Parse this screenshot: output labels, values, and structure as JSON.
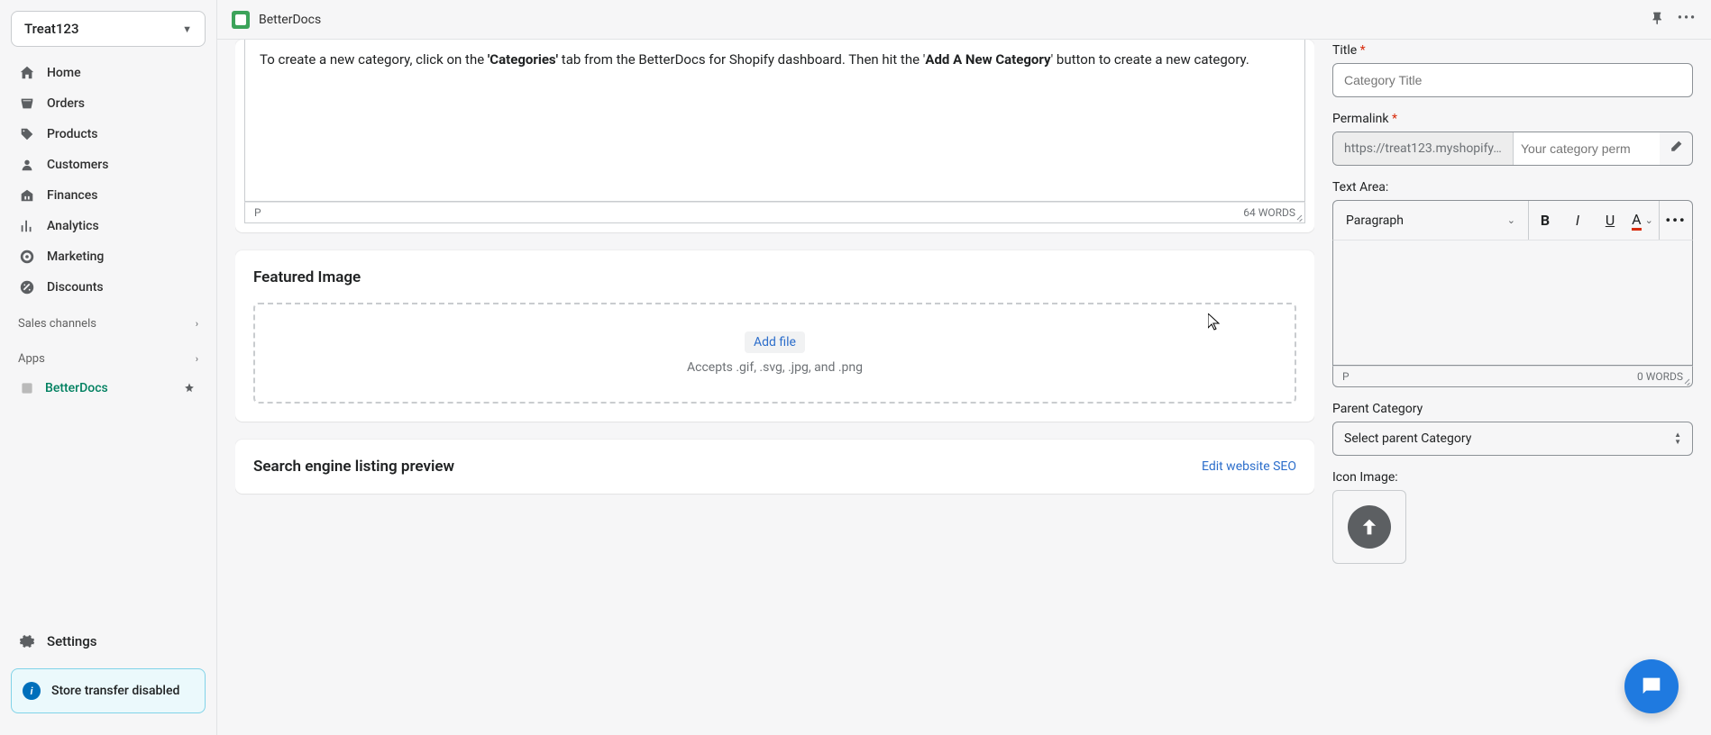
{
  "store": {
    "name": "Treat123"
  },
  "nav": {
    "home": "Home",
    "orders": "Orders",
    "products": "Products",
    "customers": "Customers",
    "finances": "Finances",
    "analytics": "Analytics",
    "marketing": "Marketing",
    "discounts": "Discounts",
    "salesChannels": "Sales channels",
    "apps": "Apps",
    "appItem": "BetterDocs",
    "settings": "Settings",
    "storeStatus": "Store transfer disabled"
  },
  "topbar": {
    "title": "BetterDocs"
  },
  "editor": {
    "body_pre": "To create a new category, click on the ",
    "body_bold1": "'Categories'",
    "body_mid": " tab from the BetterDocs for Shopify dashboard. Then hit the '",
    "body_bold2": "Add A New Category",
    "body_post": "' button to create a new category.",
    "pathLabel": "P",
    "wordCount": "64 WORDS"
  },
  "featured": {
    "title": "Featured Image",
    "addFile": "Add file",
    "accepts": "Accepts .gif, .svg, .jpg, and .png"
  },
  "seo": {
    "title": "Search engine listing preview",
    "editLink": "Edit website SEO"
  },
  "right": {
    "titleLabel": "Title",
    "titlePlaceholder": "Category Title",
    "permalinkLabel": "Permalink",
    "permalinkPrefix": "https://treat123.myshopify....",
    "permalinkPlaceholder": "Your category perm",
    "textAreaLabel": "Text Area:",
    "paragraph": "Paragraph",
    "rtePath": "P",
    "rteWords": "0 WORDS",
    "parentLabel": "Parent Category",
    "parentPlaceholder": "Select parent Category",
    "iconImageLabel": "Icon Image:"
  }
}
